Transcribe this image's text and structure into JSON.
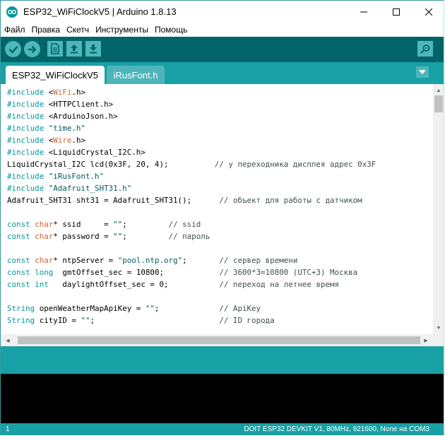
{
  "window": {
    "title": "ESP32_WiFiClockV5 | Arduino 1.8.13"
  },
  "colors": {
    "toolbar": "#006468",
    "tabbar": "#17a1a5",
    "button": "#4db7bb",
    "keyword": "#00979c",
    "type": "#cc6633"
  },
  "menu": {
    "items": [
      "Файл",
      "Правка",
      "Скетч",
      "Инструменты",
      "Помощь"
    ]
  },
  "toolbar": {
    "icons": [
      "verify-icon",
      "upload-icon",
      "new-icon",
      "open-icon",
      "save-icon",
      "serial-monitor-icon"
    ]
  },
  "tabs": [
    {
      "label": "ESP32_WiFiClockV5",
      "active": true
    },
    {
      "label": "iRusFont.h",
      "active": false
    }
  ],
  "editor": {
    "lines": [
      "#include <WiFi.h>",
      "#include <HTTPClient.h>",
      "#include <ArduinoJson.h>",
      "#include \"time.h\"",
      "#include <Wire.h>",
      "#include <LiquidCrystal_I2C.h>",
      "LiquidCrystal_I2C lcd(0x3F, 20, 4);          // у переходника дисплея адрес 0x3F",
      "#include \"iRusFont.h\"",
      "#include \"Adafruit_SHT31.h\"",
      "Adafruit_SHT31 sht31 = Adafruit_SHT31();      // объект для работы с датчиком",
      "",
      "const char* ssid     = \"\";         // ssid",
      "const char* password = \"\";         // пароль",
      "",
      "const char* ntpServer = \"pool.ntp.org\";       // сервер времени",
      "const long  gmtOffset_sec = 10800;            // 3600*3=10800 (UTC+3) Москва",
      "const int   daylightOffset_sec = 0;           // переход на летнее время",
      "",
      "String openWeatherMapApiKey = \"\";             // ApiKey",
      "String cityID = \"\";                           // ID города"
    ]
  },
  "statusbar": {
    "line": "1",
    "board": "DOIT ESP32 DEVKIT V1, 80MHz, 921600, None на COM3"
  }
}
